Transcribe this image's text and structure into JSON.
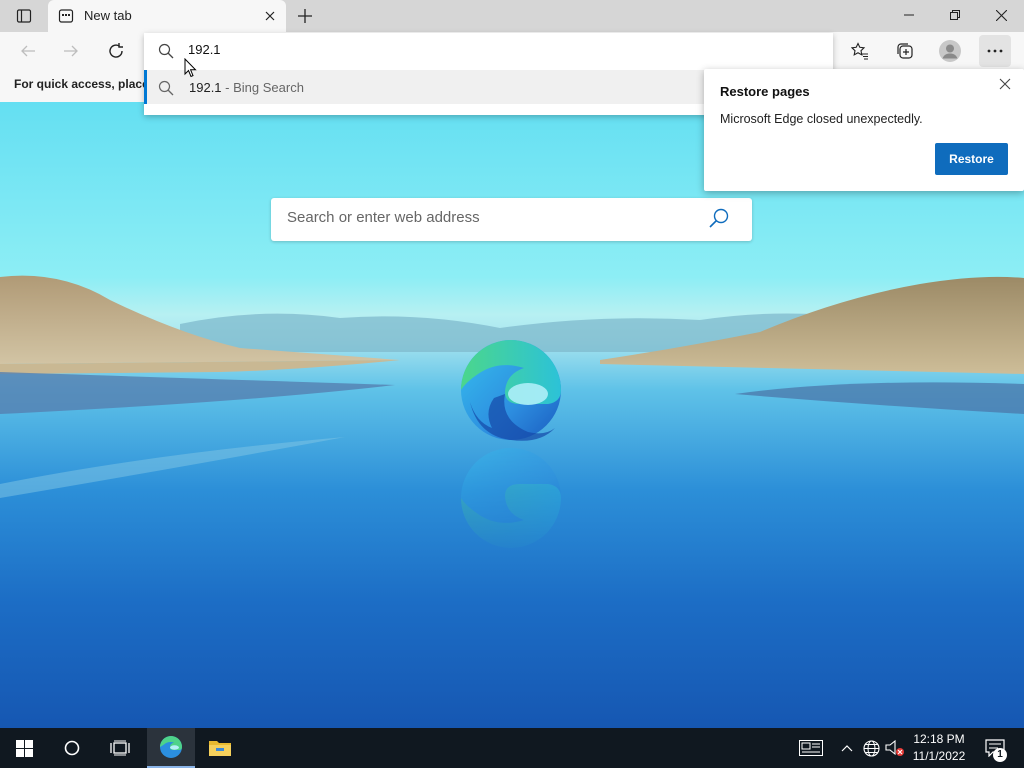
{
  "browser": {
    "tab": {
      "title": "New tab"
    },
    "omnibox": {
      "value": "192.1",
      "suggestion": {
        "main": "192.1",
        "sub": " - Bing Search"
      }
    },
    "favorites_bar_text": "For quick access, place y"
  },
  "ntp": {
    "search_placeholder": "Search or enter web address"
  },
  "restore_popup": {
    "title": "Restore pages",
    "message": "Microsoft Edge closed unexpectedly.",
    "button": "Restore"
  },
  "taskbar": {
    "time": "12:18 PM",
    "date": "11/1/2022",
    "notification_count": "1"
  },
  "colors": {
    "accent": "#0f6cbd",
    "suggestion_bar": "#0078d4",
    "taskbar": "#101820"
  }
}
